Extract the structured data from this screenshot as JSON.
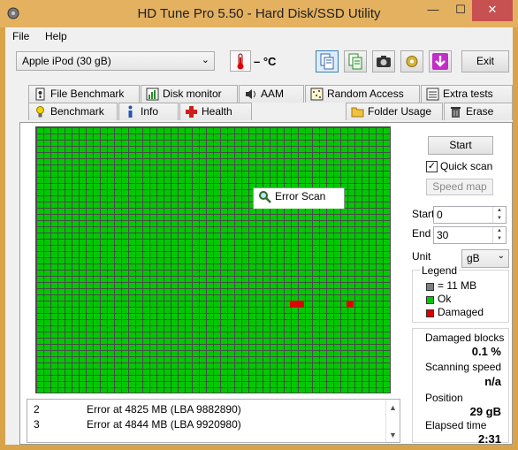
{
  "window": {
    "title": "HD Tune Pro 5.50 - Hard Disk/SSD Utility",
    "min_glyph": "—",
    "max_glyph": "☐",
    "close_glyph": "✕"
  },
  "menu": {
    "items": [
      "File",
      "Help"
    ]
  },
  "toolbar": {
    "device": "Apple   iPod (30 gB)",
    "temperature": "– °C",
    "exit_label": "Exit",
    "icons": [
      "copy-info-icon",
      "copy-text-icon",
      "screenshot-icon",
      "options-icon",
      "update-icon"
    ]
  },
  "tabs": {
    "top_row": [
      "File Benchmark",
      "Disk monitor",
      "AAM",
      "Random Access",
      "Extra tests"
    ],
    "bottom_row": [
      "Benchmark",
      "Info",
      "Health",
      "Error Scan",
      "Folder Usage",
      "Erase"
    ],
    "active": "Error Scan"
  },
  "scan": {
    "start_label": "Start",
    "quick_scan_label": "Quick scan",
    "quick_scan_checked": true,
    "speed_map_label": "Speed map",
    "start_field_label": "Start",
    "start_value": "0",
    "end_field_label": "End",
    "end_value": "30",
    "unit_label": "Unit",
    "unit_value": "gB"
  },
  "legend": {
    "title": "Legend",
    "items": [
      {
        "label": "= 11 MB",
        "color": "#7f7f7f"
      },
      {
        "label": "Ok",
        "color": "#00c800"
      },
      {
        "label": "Damaged",
        "color": "#e00000"
      }
    ]
  },
  "stats": {
    "damaged_blocks_label": "Damaged blocks",
    "damaged_blocks_value": "0.1 %",
    "scanning_speed_label": "Scanning speed",
    "scanning_speed_value": "n/a",
    "position_label": "Position",
    "position_value": "29 gB",
    "elapsed_label": "Elapsed time",
    "elapsed_value": "2:31"
  },
  "errors": [
    {
      "num": "2",
      "text": "Error at 4825 MB (LBA 9882890)"
    },
    {
      "num": "3",
      "text": "Error at 4844 MB (LBA 9920980)"
    }
  ],
  "colors": {
    "ok": "#00c800",
    "damaged": "#e00000",
    "title_bar": "#e3b160"
  }
}
